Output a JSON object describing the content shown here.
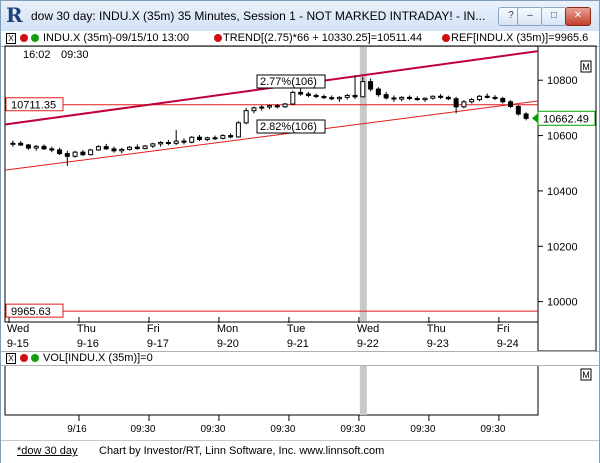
{
  "window": {
    "title": "dow 30 day: INDU.X (35m) 35 Minutes, Session 1 - NOT MARKED INTRADAY! - IN...",
    "buttons": {
      "help": "?",
      "minimize": "–",
      "maximize": "□",
      "close": "✕"
    }
  },
  "toolbar": {
    "series_label": "INDU.X (35m)-09/15/10 13:00",
    "trend_label": "TREND[(2.75)*66 + 10330.25]=10511.44",
    "ref_label": "REF[INDU.X (35m)]=9965.6",
    "close_box": "X",
    "header_time": "16:02",
    "header_time2": "09:30"
  },
  "colors": {
    "candle_up": "#ffffff",
    "candle_down": "#000000",
    "trend_upper": "#c0003a",
    "trend_lower": "#e31a1c",
    "ref_line": "#e31a1c",
    "highlight_bar": "#c8c8c8",
    "price_tag": "#00a000"
  },
  "annotations": {
    "upper_channel": "2.77%(106)",
    "lower_channel": "2.82%(106)",
    "level_10711": "10711.35",
    "level_9965": "9965.63",
    "last_price": "10662.49"
  },
  "vol_pane": {
    "label": "VOL[INDU.X (35m)]=0",
    "box": "M"
  },
  "main_pane_box": "M",
  "footer": {
    "link": "*dow 30 day",
    "credit": "Chart by Investor/RT, Linn Software, Inc. www.linnsoft.com"
  },
  "chart_data": {
    "type": "candlestick",
    "title": "dow 30 day: INDU.X (35m) 35 Minutes, Session 1",
    "ylim": [
      9930,
      10920
    ],
    "y_ticks": [
      10000,
      10200,
      10400,
      10600,
      10800
    ],
    "x_day_labels": [
      {
        "dow": "Wed",
        "date": "9-15"
      },
      {
        "dow": "Thu",
        "date": "9-16"
      },
      {
        "dow": "Fri",
        "date": "9-17"
      },
      {
        "dow": "Mon",
        "date": "9-20"
      },
      {
        "dow": "Tue",
        "date": "9-21"
      },
      {
        "dow": "Wed",
        "date": "9-22"
      },
      {
        "dow": "Thu",
        "date": "9-23"
      },
      {
        "dow": "Fri",
        "date": "9-24"
      }
    ],
    "x_time_labels": [
      "9/16",
      "09:30",
      "09:30",
      "09:30",
      "09:30",
      "09:30",
      "09:30"
    ],
    "reference_lines": [
      10711.35,
      9965.63
    ],
    "last_price": 10662.49,
    "trend_upper": {
      "start": 10640,
      "end": 10905
    },
    "trend_lower": {
      "start": 10475,
      "end": 10725
    },
    "candles": [
      {
        "o": 10570,
        "h": 10582,
        "l": 10560,
        "c": 10572
      },
      {
        "o": 10572,
        "h": 10580,
        "l": 10562,
        "c": 10566
      },
      {
        "o": 10566,
        "h": 10570,
        "l": 10548,
        "c": 10555
      },
      {
        "o": 10555,
        "h": 10566,
        "l": 10545,
        "c": 10561
      },
      {
        "o": 10561,
        "h": 10568,
        "l": 10548,
        "c": 10552
      },
      {
        "o": 10552,
        "h": 10560,
        "l": 10540,
        "c": 10548
      },
      {
        "o": 10548,
        "h": 10556,
        "l": 10530,
        "c": 10535
      },
      {
        "o": 10535,
        "h": 10545,
        "l": 10490,
        "c": 10525
      },
      {
        "o": 10525,
        "h": 10545,
        "l": 10520,
        "c": 10540
      },
      {
        "o": 10540,
        "h": 10548,
        "l": 10526,
        "c": 10531
      },
      {
        "o": 10531,
        "h": 10552,
        "l": 10528,
        "c": 10548
      },
      {
        "o": 10548,
        "h": 10565,
        "l": 10545,
        "c": 10560
      },
      {
        "o": 10560,
        "h": 10570,
        "l": 10548,
        "c": 10552
      },
      {
        "o": 10552,
        "h": 10560,
        "l": 10538,
        "c": 10545
      },
      {
        "o": 10545,
        "h": 10556,
        "l": 10536,
        "c": 10550
      },
      {
        "o": 10550,
        "h": 10562,
        "l": 10546,
        "c": 10558
      },
      {
        "o": 10558,
        "h": 10568,
        "l": 10549,
        "c": 10553
      },
      {
        "o": 10553,
        "h": 10566,
        "l": 10550,
        "c": 10562
      },
      {
        "o": 10562,
        "h": 10574,
        "l": 10555,
        "c": 10570
      },
      {
        "o": 10570,
        "h": 10580,
        "l": 10560,
        "c": 10575
      },
      {
        "o": 10575,
        "h": 10584,
        "l": 10565,
        "c": 10572
      },
      {
        "o": 10572,
        "h": 10620,
        "l": 10566,
        "c": 10580
      },
      {
        "o": 10580,
        "h": 10590,
        "l": 10568,
        "c": 10576
      },
      {
        "o": 10576,
        "h": 10598,
        "l": 10572,
        "c": 10594
      },
      {
        "o": 10594,
        "h": 10602,
        "l": 10580,
        "c": 10586
      },
      {
        "o": 10586,
        "h": 10596,
        "l": 10580,
        "c": 10592
      },
      {
        "o": 10592,
        "h": 10600,
        "l": 10584,
        "c": 10590
      },
      {
        "o": 10590,
        "h": 10605,
        "l": 10586,
        "c": 10600
      },
      {
        "o": 10600,
        "h": 10608,
        "l": 10590,
        "c": 10595
      },
      {
        "o": 10595,
        "h": 10652,
        "l": 10592,
        "c": 10646
      },
      {
        "o": 10646,
        "h": 10700,
        "l": 10640,
        "c": 10690
      },
      {
        "o": 10690,
        "h": 10705,
        "l": 10680,
        "c": 10700
      },
      {
        "o": 10700,
        "h": 10710,
        "l": 10690,
        "c": 10703
      },
      {
        "o": 10703,
        "h": 10712,
        "l": 10695,
        "c": 10708
      },
      {
        "o": 10708,
        "h": 10714,
        "l": 10698,
        "c": 10704
      },
      {
        "o": 10704,
        "h": 10718,
        "l": 10700,
        "c": 10714
      },
      {
        "o": 10714,
        "h": 10762,
        "l": 10710,
        "c": 10756
      },
      {
        "o": 10756,
        "h": 10770,
        "l": 10744,
        "c": 10750
      },
      {
        "o": 10750,
        "h": 10758,
        "l": 10738,
        "c": 10745
      },
      {
        "o": 10745,
        "h": 10752,
        "l": 10736,
        "c": 10741
      },
      {
        "o": 10741,
        "h": 10748,
        "l": 10732,
        "c": 10737
      },
      {
        "o": 10737,
        "h": 10745,
        "l": 10728,
        "c": 10733
      },
      {
        "o": 10733,
        "h": 10742,
        "l": 10722,
        "c": 10738
      },
      {
        "o": 10738,
        "h": 10750,
        "l": 10730,
        "c": 10745
      },
      {
        "o": 10745,
        "h": 10818,
        "l": 10732,
        "c": 10740
      },
      {
        "o": 10740,
        "h": 10812,
        "l": 10738,
        "c": 10795
      },
      {
        "o": 10795,
        "h": 10806,
        "l": 10760,
        "c": 10768
      },
      {
        "o": 10768,
        "h": 10775,
        "l": 10740,
        "c": 10748
      },
      {
        "o": 10748,
        "h": 10758,
        "l": 10730,
        "c": 10736
      },
      {
        "o": 10736,
        "h": 10745,
        "l": 10722,
        "c": 10732
      },
      {
        "o": 10732,
        "h": 10742,
        "l": 10724,
        "c": 10738
      },
      {
        "o": 10738,
        "h": 10745,
        "l": 10728,
        "c": 10734
      },
      {
        "o": 10734,
        "h": 10742,
        "l": 10726,
        "c": 10730
      },
      {
        "o": 10730,
        "h": 10738,
        "l": 10722,
        "c": 10735
      },
      {
        "o": 10735,
        "h": 10745,
        "l": 10730,
        "c": 10742
      },
      {
        "o": 10742,
        "h": 10750,
        "l": 10732,
        "c": 10738
      },
      {
        "o": 10738,
        "h": 10744,
        "l": 10728,
        "c": 10733
      },
      {
        "o": 10733,
        "h": 10740,
        "l": 10680,
        "c": 10704
      },
      {
        "o": 10704,
        "h": 10728,
        "l": 10698,
        "c": 10722
      },
      {
        "o": 10722,
        "h": 10736,
        "l": 10716,
        "c": 10730
      },
      {
        "o": 10730,
        "h": 10746,
        "l": 10724,
        "c": 10742
      },
      {
        "o": 10742,
        "h": 10752,
        "l": 10734,
        "c": 10738
      },
      {
        "o": 10738,
        "h": 10746,
        "l": 10728,
        "c": 10734
      },
      {
        "o": 10734,
        "h": 10740,
        "l": 10716,
        "c": 10722
      },
      {
        "o": 10722,
        "h": 10728,
        "l": 10700,
        "c": 10705
      },
      {
        "o": 10705,
        "h": 10712,
        "l": 10672,
        "c": 10678
      },
      {
        "o": 10678,
        "h": 10684,
        "l": 10655,
        "c": 10662
      }
    ]
  }
}
